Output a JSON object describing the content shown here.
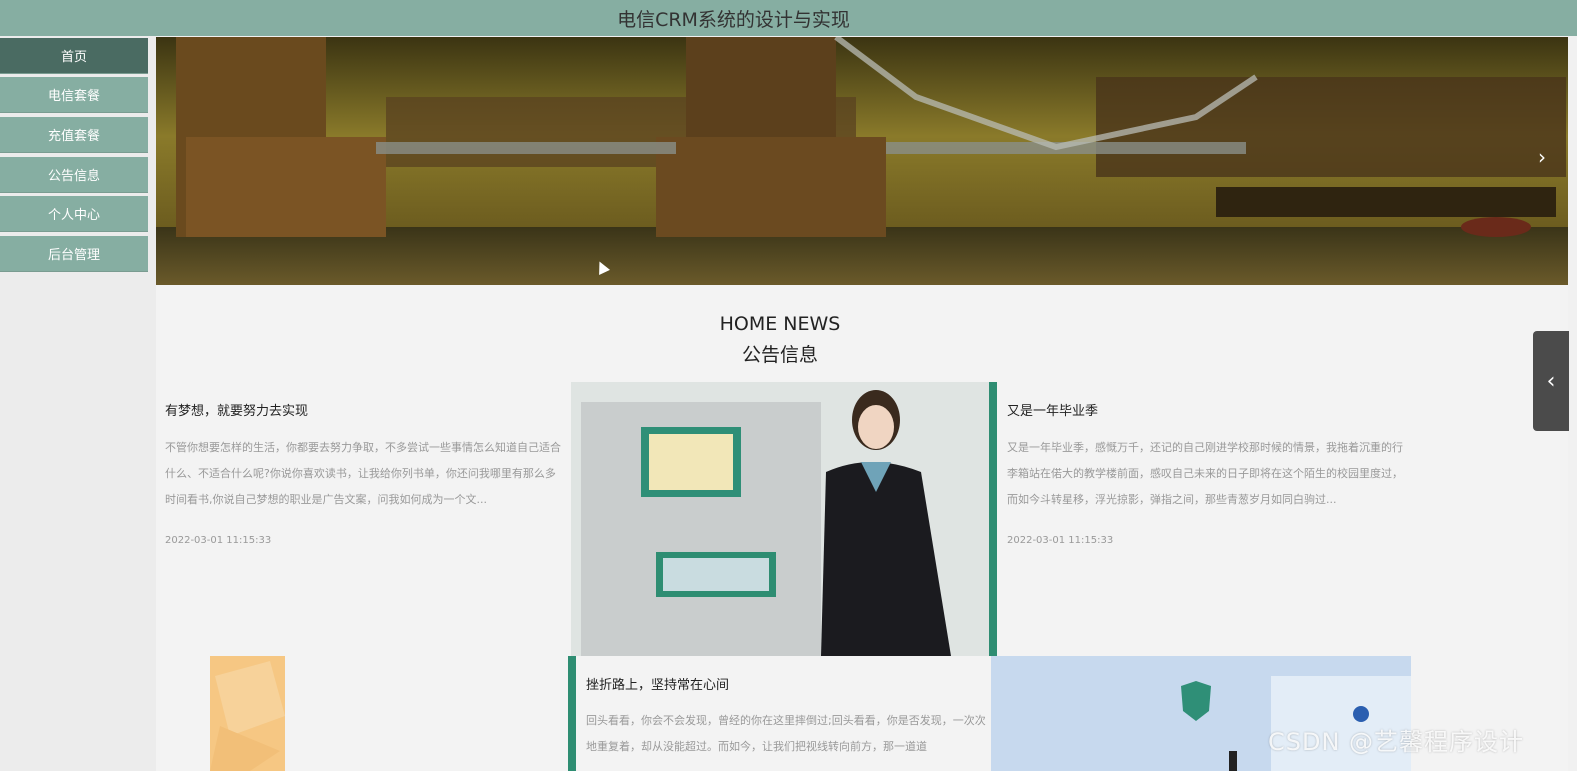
{
  "app": {
    "title": "电信CRM系统的设计与实现"
  },
  "nav": {
    "items": [
      {
        "label": "首页",
        "active": true
      },
      {
        "label": "电信套餐"
      },
      {
        "label": "充值套餐"
      },
      {
        "label": "公告信息"
      },
      {
        "label": "个人中心"
      },
      {
        "label": "后台管理"
      }
    ]
  },
  "banner": {
    "next_icon": "chevron-right-icon"
  },
  "news": {
    "title_en": "HOME NEWS",
    "title_cn": "公告信息",
    "items": [
      {
        "title": "有梦想，就要努力去实现",
        "summary": "不管你想要怎样的生活，你都要去努力争取，不多尝试一些事情怎么知道自己适合什么、不适合什么呢?你说你喜欢读书，让我给你列书单，你还问我哪里有那么多时间看书,你说自己梦想的职业是广告文案，问我如何成为一个文...",
        "date": "2022-03-01 11:15:33"
      },
      {
        "title": "又是一年毕业季",
        "summary": "又是一年毕业季，感慨万千，还记的自己刚进学校那时候的情景，我拖着沉重的行李箱站在偌大的教学楼前面，感叹自己未来的日子即将在这个陌生的校园里度过，而如今斗转星移，浮光掠影，弹指之间，那些青葱岁月如同白驹过...",
        "date": "2022-03-01 11:15:33"
      },
      {
        "title": "挫折路上，坚持常在心间",
        "summary": "回头看看，你会不会发现，曾经的你在这里摔倒过;回头看看，你是否发现，一次次地重复着，却从没能超过。而如今，让我们把视线转向前方，那一道道",
        "date": ""
      }
    ]
  },
  "side_tab": {
    "icon": "chevron-left-icon"
  },
  "watermark": "CSDN @艺馨程序设计"
}
